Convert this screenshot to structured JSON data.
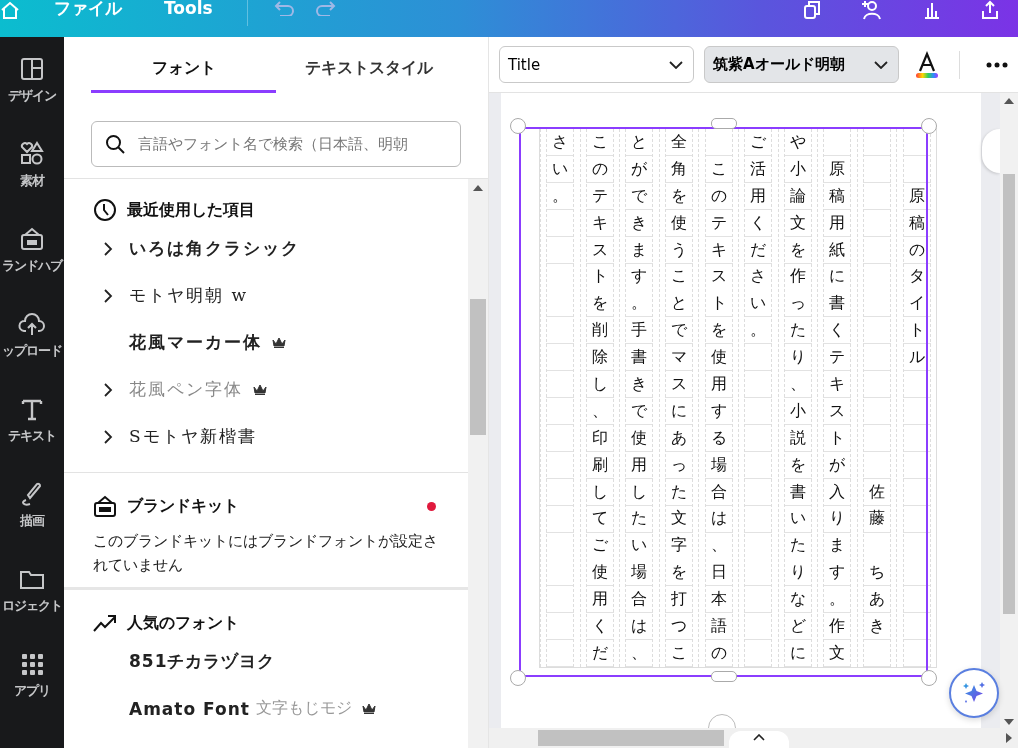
{
  "top_bar": {
    "menu": [
      {
        "label": "ファイル"
      },
      {
        "label": "Tools"
      }
    ]
  },
  "rail": [
    {
      "label": "デザイン",
      "kind": "design"
    },
    {
      "label": "素材",
      "kind": "elements"
    },
    {
      "label": "ランドハブ",
      "kind": "brand"
    },
    {
      "label": "ップロード",
      "kind": "upload"
    },
    {
      "label": "テキスト",
      "kind": "text"
    },
    {
      "label": "描画",
      "kind": "draw"
    },
    {
      "label": "ロジェクト",
      "kind": "projects"
    },
    {
      "label": "アプリ",
      "kind": "apps"
    }
  ],
  "panel": {
    "tabs": [
      {
        "label": "フォント",
        "selected": true
      },
      {
        "label": "テキストスタイル",
        "selected": false
      }
    ],
    "search": {
      "placeholder": "言語やフォント名で検索（日本語、明朝"
    },
    "recent": {
      "title": "最近使用した項目",
      "items": [
        {
          "name": "いろは角クラシック",
          "expandable": true,
          "premium": false
        },
        {
          "name": "モトヤ明朝 w",
          "expandable": true,
          "premium": false
        },
        {
          "name": "花風マーカー体",
          "expandable": false,
          "premium": true
        },
        {
          "name": "花風ペン字体",
          "expandable": true,
          "premium": true
        },
        {
          "name": "Sモトヤ新楷書",
          "expandable": true,
          "premium": false
        }
      ]
    },
    "brand_kit": {
      "title": "ブランドキット",
      "notification": true,
      "description": "このブランドキットにはブランドフォントが設定されていません"
    },
    "popular": {
      "title": "人気のフォント",
      "items": [
        {
          "name": "851チカラヅヨク",
          "premium": false
        },
        {
          "name": "Amato Font",
          "sample": "文字もじモジ",
          "premium": true
        }
      ]
    }
  },
  "toolbar": {
    "style_dropdown": "Title",
    "font_dropdown": "筑紫Aオールド明朝"
  },
  "manuscript": {
    "columns": [
      [
        "さい。"
      ],
      [
        "このテキストを削除し、印刷してご使用くだ"
      ],
      [
        "とができます。手書きで使用したい場合は、"
      ],
      [
        "全角を使うことでマスにあった文字を打つこ"
      ],
      [
        "　このテキストを使用する場合は、日本語の"
      ],
      [
        "ご活用ください。"
      ],
      [
        "や小論文を作ったり、小説を書いたりなどに"
      ],
      [
        "　原稿用紙に書くテキストが入ります。作文"
      ],
      [
        "　　　　　　　　　　　　　佐藤",
        "　ちあき"
      ],
      [
        "　　原稿のタイトル"
      ]
    ]
  }
}
